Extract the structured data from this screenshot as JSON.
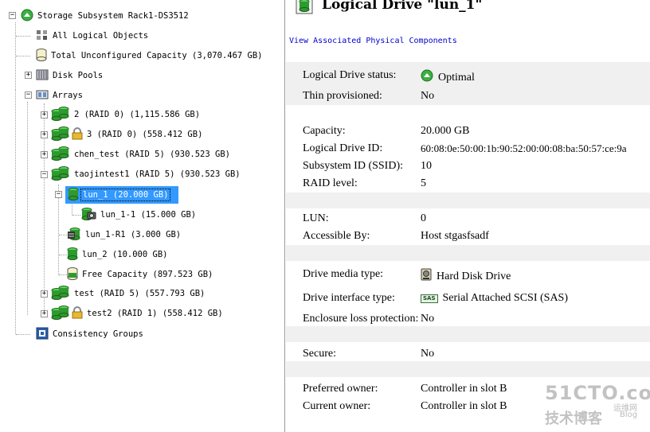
{
  "tree": {
    "root": "Storage Subsystem Rack1-DS3512",
    "all_logical_objects": "All Logical Objects",
    "total_unconfigured": "Total Unconfigured Capacity (3,070.467 GB)",
    "disk_pools": "Disk Pools",
    "arrays": "Arrays",
    "array_2": "2 (RAID 0) (1,115.586 GB)",
    "array_3": "3 (RAID 0) (558.412 GB)",
    "array_chen_test": "chen_test (RAID 5) (930.523 GB)",
    "array_taojintest1": "taojintest1 (RAID 5) (930.523 GB)",
    "lun_1": "lun_1 (20.000 GB)",
    "lun_1_1": "lun_1-1 (15.000 GB)",
    "lun_1_r1": "lun_1-R1 (3.000 GB)",
    "lun_2": "lun_2 (10.000 GB)",
    "free_capacity": "Free Capacity (897.523 GB)",
    "array_test": "test (RAID 5) (557.793 GB)",
    "array_test2": "test2 (RAID 1) (558.412 GB)",
    "consistency_groups": "Consistency Groups"
  },
  "detail": {
    "title": "Logical Drive \"lun_1\"",
    "view_link": "View Associated Physical Components",
    "properties": [
      {
        "label": "Logical Drive status:",
        "value": "Optimal",
        "icon": "optimal-status-icon"
      },
      {
        "label": "Thin provisioned:",
        "value": "No"
      },
      {
        "label": "Capacity:",
        "value": "20.000 GB"
      },
      {
        "label": "Logical Drive ID:",
        "value": "60:08:0e:50:00:1b:90:52:00:00:08:ba:50:57:ce:9a"
      },
      {
        "label": "Subsystem ID (SSID):",
        "value": "10"
      },
      {
        "label": "RAID level:",
        "value": "5"
      },
      {
        "label": "LUN:",
        "value": "0"
      },
      {
        "label": "Accessible By:",
        "value": "Host stgasfsadf"
      },
      {
        "label": "Drive media type:",
        "value": "Hard Disk Drive",
        "icon": "hard-disk-icon"
      },
      {
        "label": "Drive interface type:",
        "value": "Serial Attached SCSI (SAS)",
        "icon": "sas-icon",
        "icon_text": "SAS"
      },
      {
        "label": "Enclosure loss protection:",
        "value": "No"
      },
      {
        "label": "Secure:",
        "value": "No"
      },
      {
        "label": "Preferred owner:",
        "value": "Controller in slot B"
      },
      {
        "label": "Current owner:",
        "value": "Controller in slot B"
      }
    ]
  },
  "watermark": {
    "main": "51CTO.com",
    "sub": "技术博客",
    "small": "运维网",
    "blog": "Blog"
  },
  "colors": {
    "selection": "#3399ff",
    "link": "#0000cc",
    "band": "#f0f0f0",
    "drive_green": "#2e9a2e",
    "optimal_green": "#3cb043"
  }
}
